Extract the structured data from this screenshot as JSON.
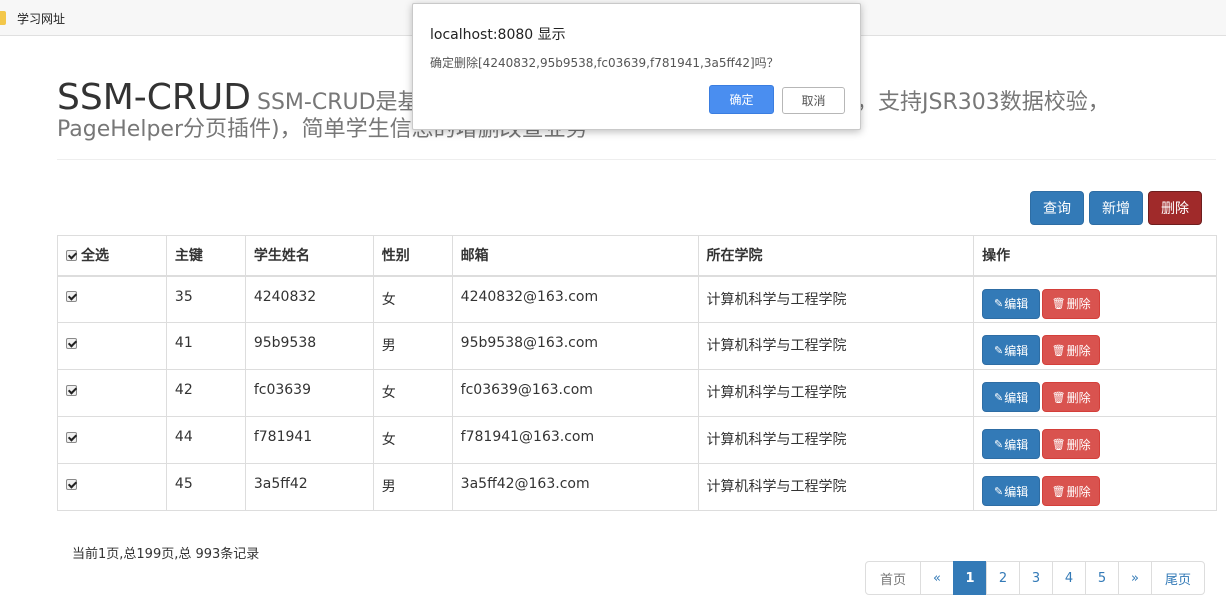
{
  "bookmarks": {
    "item_label": "学习网址"
  },
  "header": {
    "title": "SSM-CRUD",
    "subtitle_line1": "SSM-CRUD是基于SSM框架(Spring+SpringMVC+MyBatis，支持JSR303数据校验，",
    "subtitle_line2": "PageHelper分页插件)，简单学生信息的增删改查业务"
  },
  "toolbar": {
    "query_label": "查询",
    "add_label": "新增",
    "delete_label": "删除"
  },
  "table": {
    "headers": {
      "select_all": "全选",
      "id": "主键",
      "name": "学生姓名",
      "gender": "性别",
      "email": "邮箱",
      "college": "所在学院",
      "actions": "操作"
    },
    "edit_label": "编辑",
    "delete_label": "删除",
    "rows": [
      {
        "id": "35",
        "name": "4240832",
        "gender": "女",
        "email": "4240832@163.com",
        "college": "计算机科学与工程学院",
        "checked": true
      },
      {
        "id": "41",
        "name": "95b9538",
        "gender": "男",
        "email": "95b9538@163.com",
        "college": "计算机科学与工程学院",
        "checked": true
      },
      {
        "id": "42",
        "name": "fc03639",
        "gender": "女",
        "email": "fc03639@163.com",
        "college": "计算机科学与工程学院",
        "checked": true
      },
      {
        "id": "44",
        "name": "f781941",
        "gender": "女",
        "email": "f781941@163.com",
        "college": "计算机科学与工程学院",
        "checked": true
      },
      {
        "id": "45",
        "name": "3a5ff42",
        "gender": "男",
        "email": "3a5ff42@163.com",
        "college": "计算机科学与工程学院",
        "checked": true
      }
    ]
  },
  "footer": {
    "summary": "当前1页,总199页,总 993条记录",
    "pager": {
      "first": "首页",
      "prev": "«",
      "pages": [
        "1",
        "2",
        "3",
        "4",
        "5"
      ],
      "active_page": "1",
      "next": "»",
      "last": "尾页"
    }
  },
  "dialog": {
    "title": "localhost:8080 显示",
    "message": "确定删除[4240832,95b9538,fc03639,f781941,3a5ff42]吗？",
    "ok_label": "确定",
    "cancel_label": "取消"
  },
  "colors": {
    "primary": "#337ab7",
    "danger": "#d9534f",
    "danger_dark": "#a02a2a",
    "dialog_ok": "#4a8ef0"
  }
}
